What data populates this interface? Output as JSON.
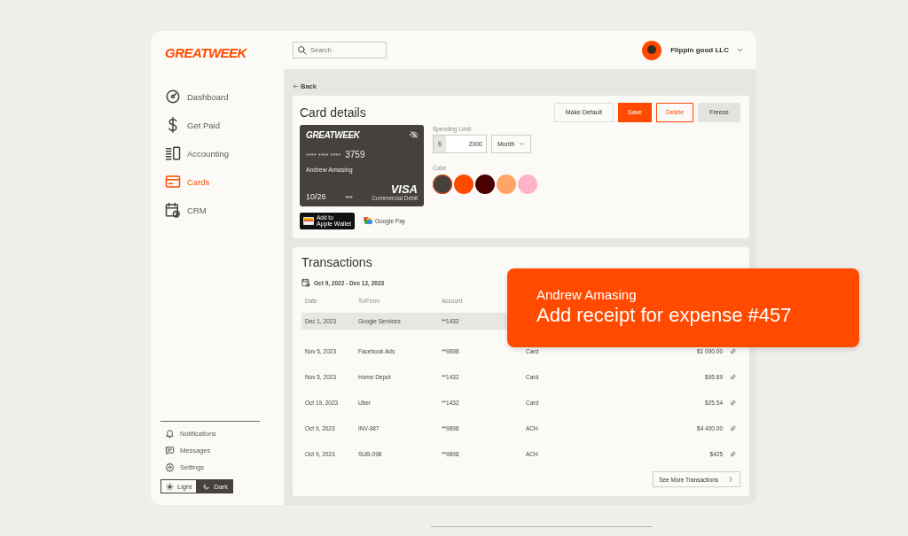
{
  "logo": "GREATWEEK",
  "sidebar": {
    "items": [
      {
        "label": "Dashboard",
        "kind": "gauge",
        "selected": false
      },
      {
        "label": "Get Paid",
        "kind": "dollar",
        "selected": false
      },
      {
        "label": "Accounting",
        "kind": "ledger",
        "selected": false
      },
      {
        "label": "Cards",
        "kind": "card",
        "selected": true
      },
      {
        "label": "CRM",
        "kind": "calendar",
        "selected": false
      }
    ],
    "footer_items": [
      {
        "label": "Notifications",
        "kind": "bell"
      },
      {
        "label": "Messages",
        "kind": "message"
      },
      {
        "label": "Settings",
        "kind": "gear"
      }
    ],
    "theme_toggle": [
      {
        "label": "Light",
        "kind": "sun",
        "selected": true
      },
      {
        "label": "Dark",
        "kind": "moon",
        "selected": false
      }
    ]
  },
  "topbar": {
    "search": {
      "placeholder": "Search"
    },
    "account": {
      "name": "Flippin good LLC"
    }
  },
  "back": "Back",
  "card_details": {
    "title": "Card details",
    "buttons": [
      {
        "label": "Make Default",
        "kind": "outline"
      },
      {
        "label": "Save",
        "kind": "primary"
      },
      {
        "label": "Delete",
        "kind": "danger"
      },
      {
        "label": "Freeze",
        "kind": "muted"
      }
    ],
    "card": {
      "brand": "GREATWEEK",
      "masked": "**** **** ****",
      "last4": "3759",
      "holder": "Andrew Amasing",
      "expiry": "10/26",
      "cvv": "***",
      "network": "VISA",
      "network_sub": "Commercial Debit"
    },
    "wallets": [
      {
        "kind": "apple",
        "label": "Add to",
        "label2": "Apple Wallet"
      },
      {
        "kind": "google",
        "label": "Google Pay"
      }
    ],
    "spending_limit": {
      "label": "Spending Limit",
      "currency": "$",
      "value": "2000",
      "period": "Month"
    },
    "color": {
      "label": "Color",
      "swatches": [
        {
          "color": "#45423e",
          "selected": true
        },
        {
          "color": "#ff4a00",
          "selected": false
        },
        {
          "color": "#4a0000",
          "selected": false
        },
        {
          "color": "#ffa366",
          "selected": false
        },
        {
          "color": "#ffb3c6",
          "selected": false
        }
      ]
    }
  },
  "transactions": {
    "title": "Transactions",
    "date_range": "Oct 9, 2022 - Dec 12, 2023",
    "columns": [
      "Date",
      "To/From",
      "Account"
    ],
    "rows": [
      {
        "date": "Dec 1, 2023",
        "party": "Google Services",
        "account": "**1432",
        "selected": true
      },
      {
        "date": "Nov 5, 2023",
        "party": "Facebook Ads",
        "account": "**9898",
        "type": "Card",
        "amount": "$1 000.00",
        "selected": false
      },
      {
        "date": "Nov 5, 2023",
        "party": "Home Depot",
        "account": "**1432",
        "type": "Card",
        "amount": "$95.89",
        "selected": false
      },
      {
        "date": "Oct 19, 2023",
        "party": "Uber",
        "account": "**1432",
        "type": "Card",
        "amount": "$25.54",
        "selected": false
      },
      {
        "date": "Oct 9, 2023",
        "party": "INV-987",
        "account": "**9898",
        "type": "ACH",
        "amount": "$4 400.00",
        "selected": false
      },
      {
        "date": "Oct 9, 2023",
        "party": "SUB-098",
        "account": "**9898",
        "type": "ACH",
        "amount": "$425",
        "selected": false
      }
    ],
    "see_more": "See More Transactions"
  },
  "toast": {
    "name": "Andrew Amasing",
    "message": "Add receipt for expense #457"
  }
}
